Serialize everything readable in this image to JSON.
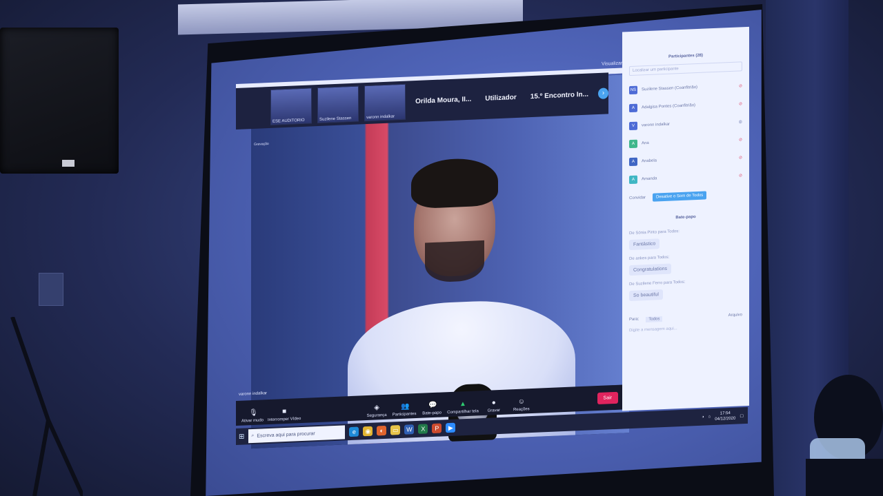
{
  "zoom": {
    "view_label": "Visualizar",
    "thumbnails": [
      {
        "label": "ESE AUDITORIO"
      },
      {
        "label": "Suzilene Stassen"
      },
      {
        "label": "varonn indalkar"
      }
    ],
    "thumb_texts": [
      "Orilda Moura, II...",
      "Utilizador",
      "15.º Encontro In..."
    ],
    "next_icon": "chevron-right-icon",
    "recording": "Gravação",
    "speaker_name": "varonn indalkar",
    "toolbar": {
      "mute": "Ativar mudo",
      "stop_video": "Interromper Vídeo",
      "security": "Segurança",
      "participants": "Participantes",
      "participants_count": "28",
      "chat": "Bate-papo",
      "share": "Compartilhar tela",
      "record": "Gravar",
      "reactions": "Reações",
      "leave": "Sair"
    },
    "panel": {
      "title": "Participantes (28)",
      "search_placeholder": "Localizar um participante",
      "participants": [
        {
          "initials": "NS",
          "name": "Suzilene Stassen (Coanfitrião)"
        },
        {
          "initials": "A",
          "name": "Adalgisa Pontes (Coanfitrião)"
        },
        {
          "initials": "V",
          "name": "varonn indalkar"
        },
        {
          "initials": "A",
          "name": "Ana"
        },
        {
          "initials": "A",
          "name": "Anabela"
        },
        {
          "initials": "A",
          "name": "Amanda"
        }
      ],
      "invite": "Convidar",
      "mute_all": "Desative o Som de Todos",
      "chat_title": "Bate-papo",
      "messages": [
        {
          "from": "De Sónia Pinto para Todos:",
          "text": "Fantástico"
        },
        {
          "from": "De ankes para Todos:",
          "text": "Congratulations"
        },
        {
          "from": "De Suzilene Ferro para Todos:",
          "text": "So beautiful"
        }
      ],
      "to_label": "Para:",
      "to_value": "Todos",
      "file_label": "Arquivo",
      "type_placeholder": "Digite a mensagem aqui..."
    }
  },
  "taskbar": {
    "search_placeholder": "Escreva aqui para procurar",
    "time": "17:54",
    "date": "04/12/2020"
  }
}
